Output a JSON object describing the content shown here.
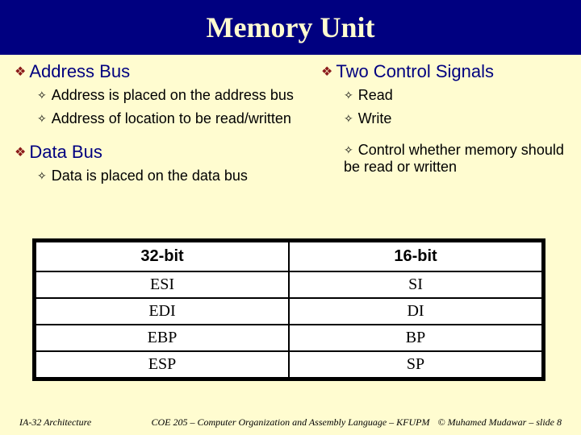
{
  "title": "Memory Unit",
  "left": {
    "h1": "Address Bus",
    "s1": "Address is placed on the address bus",
    "s2": "Address of location to be read/written",
    "h2": "Data Bus",
    "s3": "Data is placed on the data bus"
  },
  "right": {
    "h1": "Two Control Signals",
    "s1": "Read",
    "s2": "Write",
    "s3": "Control whether memory should be read or written"
  },
  "table": {
    "header1": "32-bit",
    "header2": "16-bit",
    "rows": [
      [
        "ESI",
        "SI"
      ],
      [
        "EDI",
        "DI"
      ],
      [
        "EBP",
        "BP"
      ],
      [
        "ESP",
        "SP"
      ]
    ]
  },
  "footer": {
    "left": "IA-32 Architecture",
    "mid": "COE 205 – Computer Organization and Assembly Language – KFUPM",
    "right": "© Muhamed Mudawar – slide 8"
  }
}
